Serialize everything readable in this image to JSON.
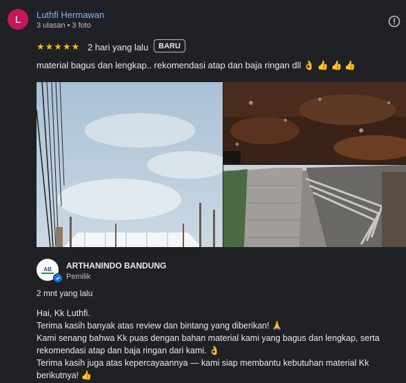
{
  "reviewer": {
    "initial": "L",
    "name": "Luthfi Hermawan",
    "meta": "3 ulasan • 3 foto",
    "avatar_color": "#c2185b"
  },
  "review": {
    "stars": "★★★★★",
    "rating": 5,
    "date": "2 hari yang lalu",
    "badge": "BARU",
    "text": "material bagus dan lengkap.. rekomendasi atap dan baja ringan dll 👌 👍 👍 👍"
  },
  "photos": [
    "photo-sky-construction",
    "photo-soil-ground",
    "photo-paved-road-roofing"
  ],
  "owner": {
    "name": "ARTHANINDO BANDUNG",
    "role": "Pemilik",
    "reply_date": "2 mnt yang lalu",
    "reply_lines": [
      "Hai, Kk Luthfi.",
      "Terima kasih banyak atas review dan bintang yang diberikan! 🙏",
      "Kami senang bahwa Kk puas dengan bahan material kami yang bagus dan lengkap, serta rekomendasi atap dan baja ringan dari kami. 👌",
      "Terima kasih juga atas kepercayaannya — kami siap membantu kebutuhan material Kk berikutnya! 👍"
    ]
  },
  "icons": {
    "report": "report-icon",
    "verified": "verified-check-icon"
  },
  "colors": {
    "background": "#202124",
    "link": "#8ab4f8",
    "star": "#fbbc04"
  }
}
